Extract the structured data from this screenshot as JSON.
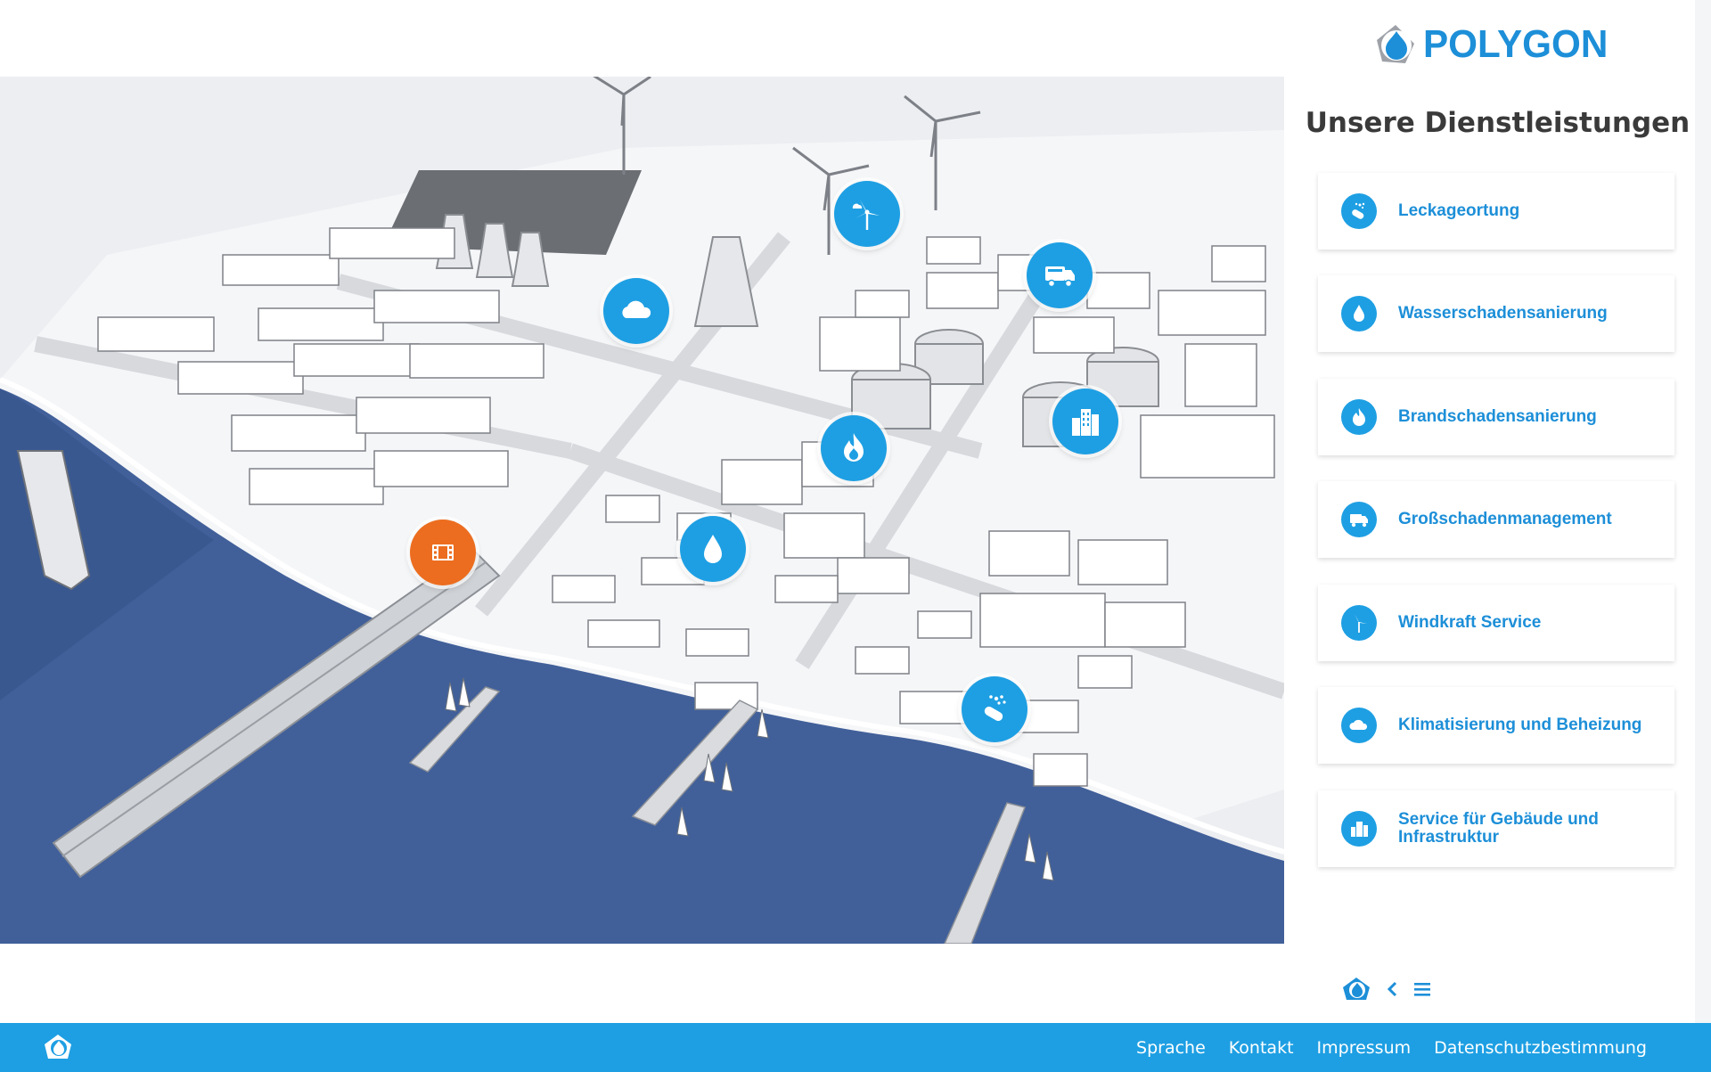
{
  "brand": {
    "name": "POLYGON",
    "color": "#1d8fd8",
    "accent": "#1e9fe3",
    "orange": "#ec6d1f"
  },
  "sidebar": {
    "title": "Unsere Dienstleistungen",
    "services": [
      {
        "label": "Leckageortung",
        "icon": "leak-detection-icon"
      },
      {
        "label": "Wasserschadensanierung",
        "icon": "water-drop-icon"
      },
      {
        "label": "Brandschadensanierung",
        "icon": "fire-icon"
      },
      {
        "label": "Großschadenmanagement",
        "icon": "truck-icon"
      },
      {
        "label": "Windkraft Service",
        "icon": "wind-turbine-icon"
      },
      {
        "label": "Klimatisierung und Beheizung",
        "icon": "cloud-icon"
      },
      {
        "label": "Service für Gebäude und Infrastruktur",
        "icon": "buildings-icon"
      }
    ]
  },
  "map": {
    "hotspots": [
      {
        "service": "Windkraft Service",
        "icon": "wind-turbine-icon"
      },
      {
        "service": "Großschadenmanagement",
        "icon": "truck-icon"
      },
      {
        "service": "Klimatisierung und Beheizung",
        "icon": "cloud-icon"
      },
      {
        "service": "Service für Gebäude und Infrastruktur",
        "icon": "buildings-icon"
      },
      {
        "service": "Brandschadensanierung",
        "icon": "fire-icon"
      },
      {
        "service": "Video",
        "icon": "film-icon"
      },
      {
        "service": "Wasserschadensanierung",
        "icon": "water-drop-icon"
      },
      {
        "service": "Leckageortung",
        "icon": "leak-detection-icon"
      }
    ]
  },
  "footer": {
    "links": [
      "Sprache",
      "Kontakt",
      "Impressum",
      "Datenschutzbestimmung"
    ]
  }
}
